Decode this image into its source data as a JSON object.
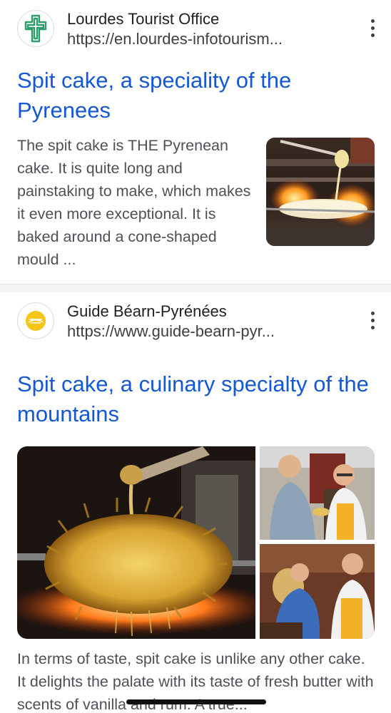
{
  "results": [
    {
      "site_name": "Lourdes Tourist Office",
      "url": "https://en.lourdes-infotourism...",
      "title": "Spit cake, a speciality of the Pyrenees",
      "snippet": "The spit cake is THE Pyrenean cake. It is quite long and painstaking to make, which makes it even more exceptional. It is baked around a cone-shaped mould ..."
    },
    {
      "site_name": "Guide Béarn-Pyrénées",
      "url": "https://www.guide-bearn-pyr...",
      "title": "Spit cake, a culinary specialty of the mountains",
      "snippet": "In terms of taste, spit cake is unlike any other cake. It delights the palate with its taste of fresh butter with scents of vanilla and rum. A true..."
    }
  ],
  "colors": {
    "link": "#1558d6",
    "snippet": "#4d5156",
    "favicon_green": "#2e9b6a",
    "favicon_yellow": "#f5c518"
  },
  "icons": {
    "more": "more-vert-icon",
    "lourdes_logo": "lourdes-cross-logo",
    "bearn_logo": "bearn-pyrenees-logo"
  }
}
